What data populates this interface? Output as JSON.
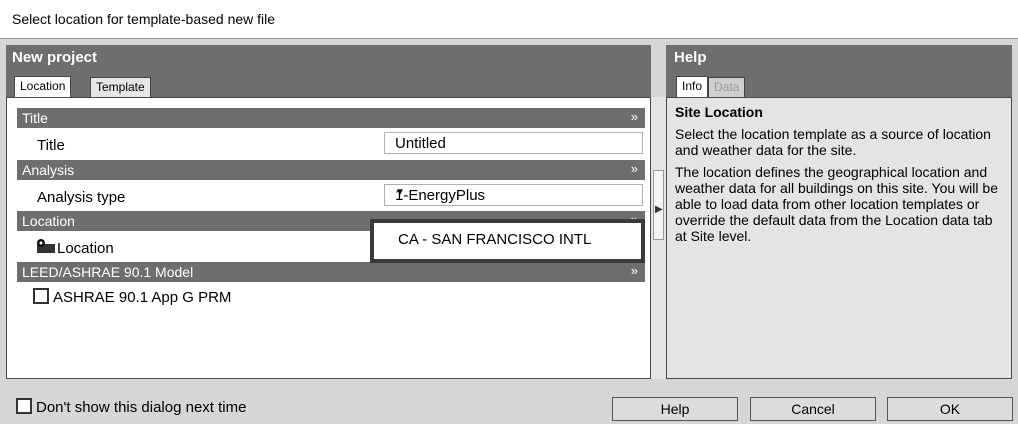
{
  "window": {
    "title": "Select location for template-based new file"
  },
  "left": {
    "header": "New project",
    "tabs": [
      {
        "label": "Location",
        "active": true
      },
      {
        "label": "Template",
        "active": false
      }
    ],
    "sections": {
      "title": {
        "label": "Title",
        "row_label": "Title",
        "row_value": "Untitled"
      },
      "analysis": {
        "label": "Analysis",
        "row_label": "Analysis type",
        "row_value": "1-EnergyPlus"
      },
      "location": {
        "label": "Location",
        "row_label": "Location",
        "row_value": "CA - SAN FRANCISCO INTL"
      },
      "leed": {
        "label": "LEED/ASHRAE 90.1 Model",
        "checkbox_label": "ASHRAE 90.1 App G PRM"
      }
    }
  },
  "help": {
    "header": "Help",
    "tabs": [
      {
        "label": "Info",
        "active": true
      },
      {
        "label": "Data",
        "active": false
      }
    ],
    "title": "Site Location",
    "paragraphs": [
      "Select the location template as a source of location and weather data for the site.",
      "The location defines the geographical location and weather data for all buildings on this site. You will be able to load data from other location templates or override the default data from the Location data tab at Site level."
    ]
  },
  "footer": {
    "dont_show": "Don't show this dialog next time",
    "help_button": "Help",
    "cancel_button": "Cancel",
    "ok_button": "OK"
  },
  "icons": {
    "collapse": "double-chevron-up-icon",
    "dropdown": "triangle-down-icon",
    "location": "location-pin-icon",
    "scroll": "triangle-right-icon"
  }
}
